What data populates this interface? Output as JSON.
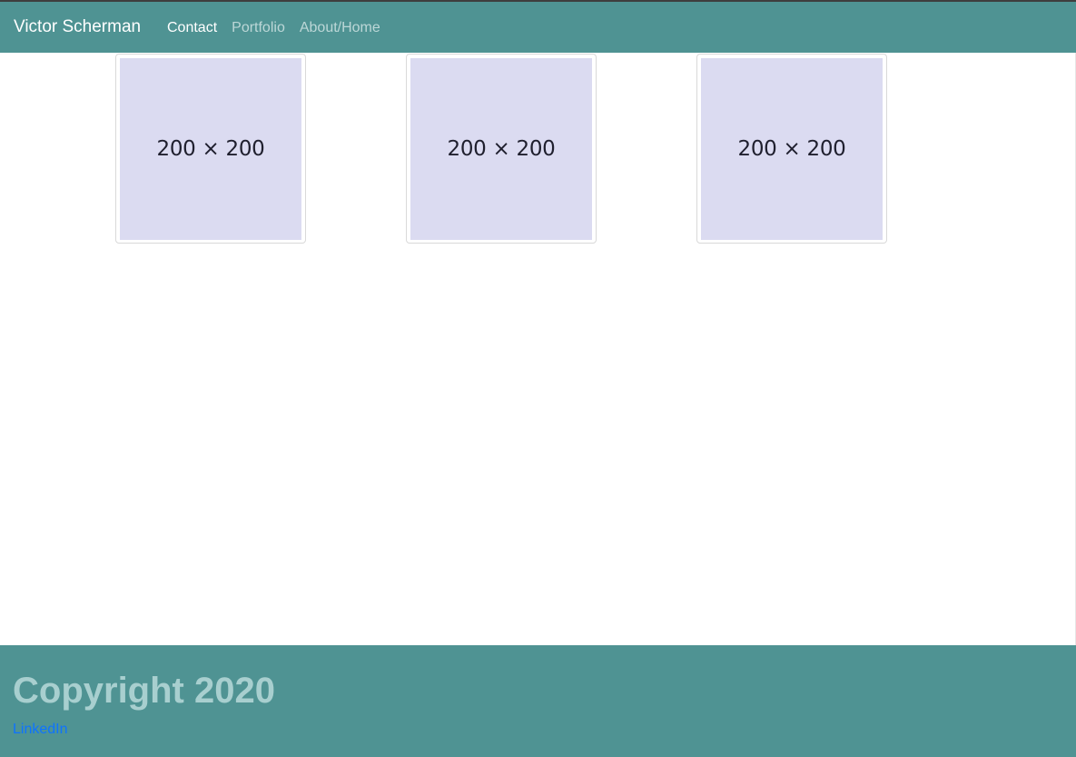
{
  "header": {
    "brand": "Victor Scherman",
    "nav": [
      {
        "label": "Contact"
      },
      {
        "label": "Portfolio"
      },
      {
        "label": "About/Home"
      }
    ]
  },
  "gallery": {
    "items": [
      {
        "label": "200 × 200"
      },
      {
        "label": "200 × 200"
      },
      {
        "label": "200 × 200"
      }
    ]
  },
  "footer": {
    "title": "Copyright 2020",
    "link": "LinkedIn"
  },
  "colors": {
    "header_bg": "#4f9393",
    "footer_bg": "#4f9393",
    "placeholder_bg": "#dbdbf1",
    "link": "#0e73ff"
  }
}
